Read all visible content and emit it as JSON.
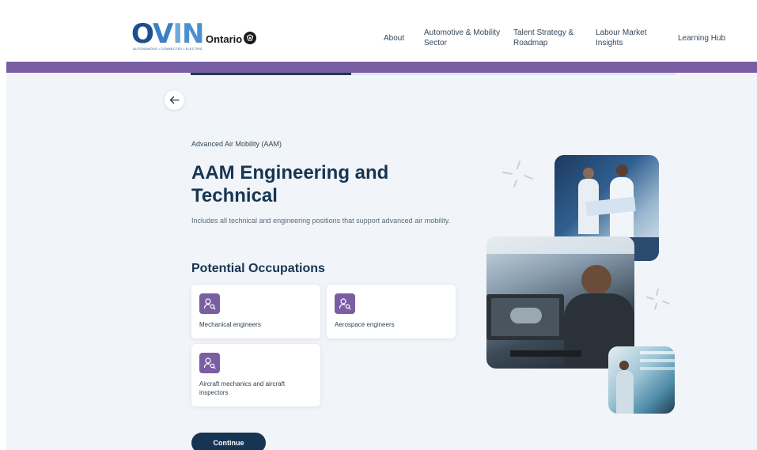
{
  "header": {
    "logo_main": "OVIN",
    "logo_tagline": "AUTONOMOUS • CONNECTED • ELECTRIC",
    "gov_name": "Ontario",
    "nav": {
      "about": "About",
      "automotive": "Automotive & Mobility Sector",
      "talent": "Talent Strategy & Roadmap",
      "labour": "Labour Market Insights",
      "learning": "Learning Hub"
    }
  },
  "progress": {
    "fraction": 0.33
  },
  "content": {
    "breadcrumb": "Advanced Air Mobility (AAM)",
    "title": "AAM Engineering and Technical",
    "description": "Includes all technical and engineering positions that support advanced air mobility.",
    "section_title": "Potential Occupations",
    "occupations": [
      {
        "label": "Mechanical engineers"
      },
      {
        "label": "Aerospace engineers"
      },
      {
        "label": "Aircraft mechanics and aircraft inspectors"
      }
    ],
    "continue_label": "Continue"
  },
  "icons": {
    "back": "arrow-left-icon",
    "occupation": "person-search-icon",
    "gov": "trillium-icon"
  },
  "colors": {
    "brand_purple": "#7a5ea3",
    "navy": "#163552",
    "background": "#f1f4f8"
  }
}
